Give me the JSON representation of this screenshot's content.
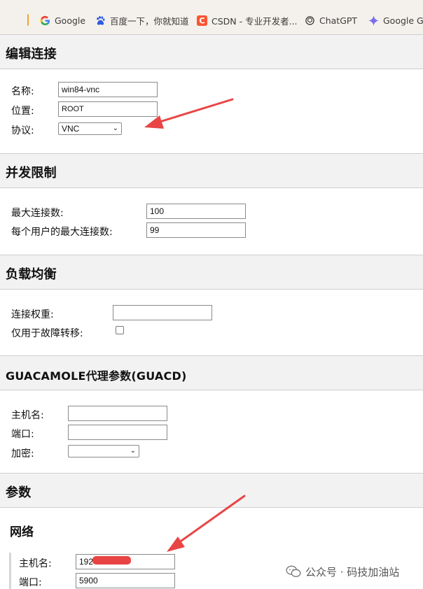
{
  "bookmarks": [
    {
      "label": "Google"
    },
    {
      "label": "百度一下，你就知道"
    },
    {
      "label": "CSDN - 专业开发者..."
    },
    {
      "label": "ChatGPT"
    },
    {
      "label": "Google Ge"
    }
  ],
  "connection": {
    "title": "编辑连接",
    "name_label": "名称:",
    "name_value": "win84-vnc",
    "location_label": "位置:",
    "location_value": "ROOT",
    "protocol_label": "协议:",
    "protocol_value": "VNC"
  },
  "concurrency": {
    "title": "并发限制",
    "max_label": "最大连接数:",
    "max_value": "100",
    "per_user_label": "每个用户的最大连接数:",
    "per_user_value": "99"
  },
  "load_balancing": {
    "title": "负载均衡",
    "weight_label": "连接权重:",
    "weight_value": "",
    "failover_label": "仅用于故障转移:",
    "failover_checked": false
  },
  "guacd": {
    "title": "GUACAMOLE代理参数(GUACD)",
    "host_label": "主机名:",
    "host_value": "",
    "port_label": "端口:",
    "port_value": "",
    "encryption_label": "加密:",
    "encryption_value": ""
  },
  "parameters": {
    "title": "参数",
    "network_title": "网络",
    "host_label": "主机名:",
    "host_value": "192",
    "port_label": "端口:",
    "port_value": "5900"
  },
  "watermark": {
    "text": "公众号 · 码技加油站"
  },
  "colors": {
    "annotation_arrow": "#e84545",
    "section_bg": "#f2f2f2"
  }
}
